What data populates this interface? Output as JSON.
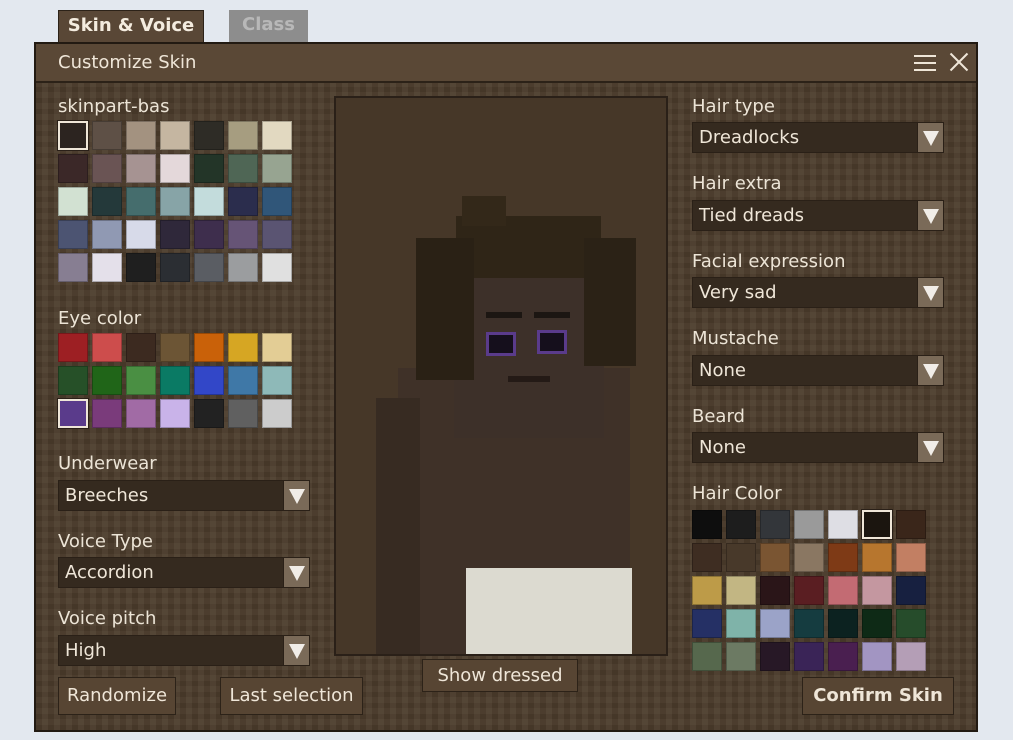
{
  "tabs": [
    {
      "label": "Skin & Voice"
    },
    {
      "label": "Class"
    }
  ],
  "dialog": {
    "title": "Customize Skin",
    "menu_icon": "hamburger-menu-icon",
    "close_icon": "close-icon"
  },
  "skin": {
    "label": "skinpart-bas",
    "selected_index": 0,
    "colors": [
      "#2c2420",
      "#5e5046",
      "#a39280",
      "#c5b6a1",
      "#2e2c26",
      "#a69d80",
      "#e2d9c1",
      "#3b2828",
      "#6a5454",
      "#a69392",
      "#e4d8da",
      "#233528",
      "#4f6655",
      "#97a491",
      "#d2e1d2",
      "#24393a",
      "#456d6d",
      "#87a4a7",
      "#c3dcdc",
      "#2b2d4d",
      "#305679",
      "#4c5472",
      "#9099b3",
      "#d7dae9",
      "#2f283a",
      "#3e2e4d",
      "#665476",
      "#5a5472",
      "#877e92",
      "#e4e0ea",
      "#1f1f1f",
      "#2b2e33",
      "#5a5d63",
      "#9b9d9f",
      "#e0e0e0"
    ]
  },
  "eye_color": {
    "label": "Eye color",
    "selected_index": 14,
    "colors": [
      "#9d1f23",
      "#cd4d4c",
      "#3c2a20",
      "#6c5535",
      "#c96109",
      "#d6a623",
      "#e3cd95",
      "#265028",
      "#206518",
      "#4a8f43",
      "#0a7a64",
      "#3247c8",
      "#3f78a7",
      "#8eb9b8",
      "#5a3b8b",
      "#7a3b7b",
      "#a16ba5",
      "#c9b3e9",
      "#222222",
      "#606060",
      "#cccccc"
    ]
  },
  "underwear": {
    "label": "Underwear",
    "value": "Breeches"
  },
  "voice_type": {
    "label": "Voice Type",
    "value": "Accordion"
  },
  "voice_pitch": {
    "label": "Voice pitch",
    "value": "High"
  },
  "buttons": {
    "randomize": "Randomize",
    "last_selection": "Last selection",
    "show_dressed": "Show dressed",
    "confirm": "Confirm Skin"
  },
  "hair_type": {
    "label": "Hair type",
    "value": "Dreadlocks"
  },
  "hair_extra": {
    "label": "Hair extra",
    "value": "Tied dreads"
  },
  "facial_expression": {
    "label": "Facial expression",
    "value": "Very sad"
  },
  "mustache": {
    "label": "Mustache",
    "value": "None"
  },
  "beard": {
    "label": "Beard",
    "value": "None"
  },
  "hair_color": {
    "label": "Hair Color",
    "selected_index": 5,
    "colors": [
      "#0e0e0e",
      "#1d1d1d",
      "#33363a",
      "#9a9a9a",
      "#dedee4",
      "#1b150f",
      "#3a261a",
      "#3e2d22",
      "#48392a",
      "#7a5532",
      "#8a7762",
      "#7e3a16",
      "#b7762e",
      "#c27f63",
      "#bd9b48",
      "#c2b683",
      "#2a1518",
      "#5a1e22",
      "#c36b73",
      "#c497a0",
      "#172040",
      "#253065",
      "#7fb3a9",
      "#9ba3c8",
      "#153c40",
      "#0c2220",
      "#0e2a16",
      "#264c2b",
      "#56684d",
      "#6c7a63",
      "#271826",
      "#3a2457",
      "#4a1f50",
      "#a295c2",
      "#b49eb6"
    ]
  },
  "colors": {
    "panel_bg": "#4c3c2c",
    "dropdown_bg": "#352a1f",
    "text": "#ece4d6",
    "page_bg": "#e3e8ef"
  }
}
